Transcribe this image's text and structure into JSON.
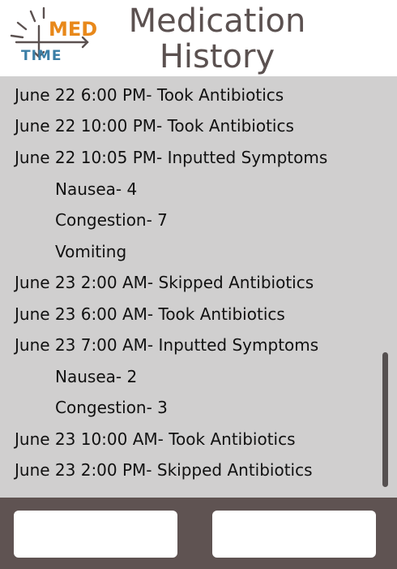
{
  "header": {
    "logo": {
      "text_top": "MED",
      "text_bottom": "TIME",
      "colors": {
        "med": "#e8881a",
        "time": "#3a7ea6",
        "frame": "#5b5150"
      }
    },
    "title_line1": "Medication",
    "title_line2": "History"
  },
  "history": {
    "entries": [
      {
        "text": "June 22 6:00 PM- Took Antibiotics",
        "indent": false
      },
      {
        "text": "June 22 10:00 PM- Took Antibiotics",
        "indent": false
      },
      {
        "text": "June 22 10:05 PM- Inputted Symptoms",
        "indent": false
      },
      {
        "text": "Nausea- 4",
        "indent": true
      },
      {
        "text": "Congestion- 7",
        "indent": true
      },
      {
        "text": "Vomiting",
        "indent": true
      },
      {
        "text": "June 23 2:00 AM- Skipped Antibiotics",
        "indent": false
      },
      {
        "text": "June 23 6:00 AM- Took Antibiotics",
        "indent": false
      },
      {
        "text": "June 23 7:00 AM- Inputted Symptoms",
        "indent": false
      },
      {
        "text": "Nausea- 2",
        "indent": true
      },
      {
        "text": "Congestion- 3",
        "indent": true
      },
      {
        "text": "June 23 10:00 AM- Took Antibiotics",
        "indent": false
      },
      {
        "text": "June 23 2:00 PM- Skipped Antibiotics",
        "indent": false
      }
    ]
  },
  "footer": {
    "left_button_label": "",
    "right_button_label": ""
  },
  "colors": {
    "title": "#5b5150",
    "panel_background": "#d0cfcf",
    "footer_background": "#5f5352",
    "scrollbar": "#555050"
  }
}
